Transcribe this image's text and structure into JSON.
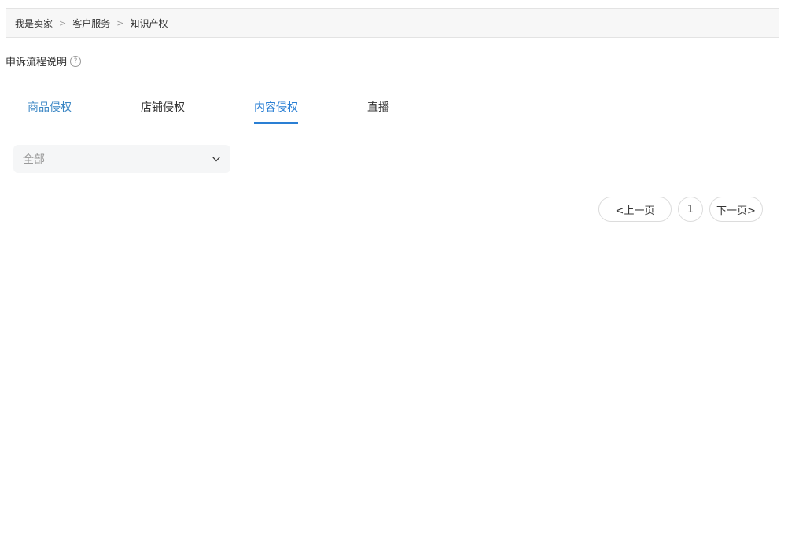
{
  "breadcrumb": {
    "items": [
      "我是卖家",
      "客户服务",
      "知识产权"
    ],
    "separator": ">"
  },
  "help": {
    "label": "申诉流程说明",
    "icon": "question-circle-icon",
    "icon_glyph": "?"
  },
  "tabs": [
    {
      "label": "商品侵权",
      "state": "blue-text"
    },
    {
      "label": "店铺侵权",
      "state": "normal"
    },
    {
      "label": "内容侵权",
      "state": "active"
    },
    {
      "label": "直播",
      "state": "normal"
    }
  ],
  "filter": {
    "selected": "全部",
    "icon": "chevron-down-icon"
  },
  "pagination": {
    "prev_label": "<上一页",
    "current_page": "1",
    "next_label": "下一页>"
  },
  "colors": {
    "accent": "#2a7fd4",
    "tab_blue_text": "#3a86c4",
    "breadcrumb_bg": "#f7f7f7",
    "select_bg": "#f5f6f7"
  }
}
